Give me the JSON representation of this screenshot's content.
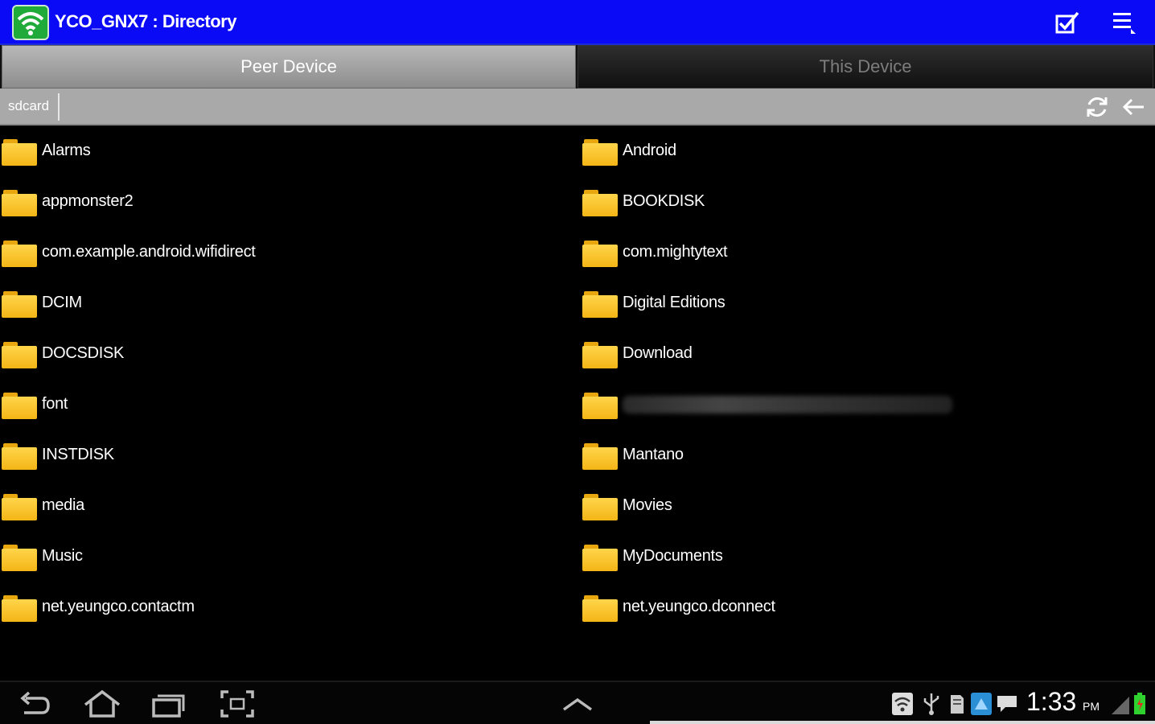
{
  "app": {
    "title": "YCO_GNX7 : Directory",
    "accent": "#0a0af6"
  },
  "actionbar": {
    "icons": [
      "wifi-app-icon",
      "checkbox-icon",
      "menu-icon"
    ]
  },
  "tabs": [
    {
      "label": "Peer Device",
      "selected": true
    },
    {
      "label": "This Device",
      "selected": false
    }
  ],
  "pathbar": {
    "path": "sdcard",
    "icons": [
      "refresh-icon",
      "back-arrow-icon"
    ]
  },
  "folders_left": [
    {
      "name": "Alarms"
    },
    {
      "name": "appmonster2"
    },
    {
      "name": "com.example.android.wifidirect"
    },
    {
      "name": "DCIM"
    },
    {
      "name": "DOCSDISK"
    },
    {
      "name": "font"
    },
    {
      "name": "INSTDISK"
    },
    {
      "name": "media"
    },
    {
      "name": "Music"
    },
    {
      "name": "net.yeungco.contactm"
    }
  ],
  "folders_right": [
    {
      "name": "Android"
    },
    {
      "name": "BOOKDISK"
    },
    {
      "name": "com.mightytext"
    },
    {
      "name": "Digital Editions"
    },
    {
      "name": "Download"
    },
    {
      "name": "",
      "blurred": true
    },
    {
      "name": "Mantano"
    },
    {
      "name": "Movies"
    },
    {
      "name": "MyDocuments"
    },
    {
      "name": "net.yeungco.dconnect"
    }
  ],
  "systembar": {
    "time": "1:33",
    "ampm": "PM",
    "nav_icons": [
      "back-icon",
      "home-icon",
      "recent-apps-icon",
      "screenshot-icon",
      "chevron-up-icon"
    ],
    "status_icons": [
      "wifi-status-icon",
      "usb-icon",
      "sdcard-icon",
      "app-notification-icon",
      "message-icon",
      "signal-icon",
      "battery-icon"
    ]
  }
}
